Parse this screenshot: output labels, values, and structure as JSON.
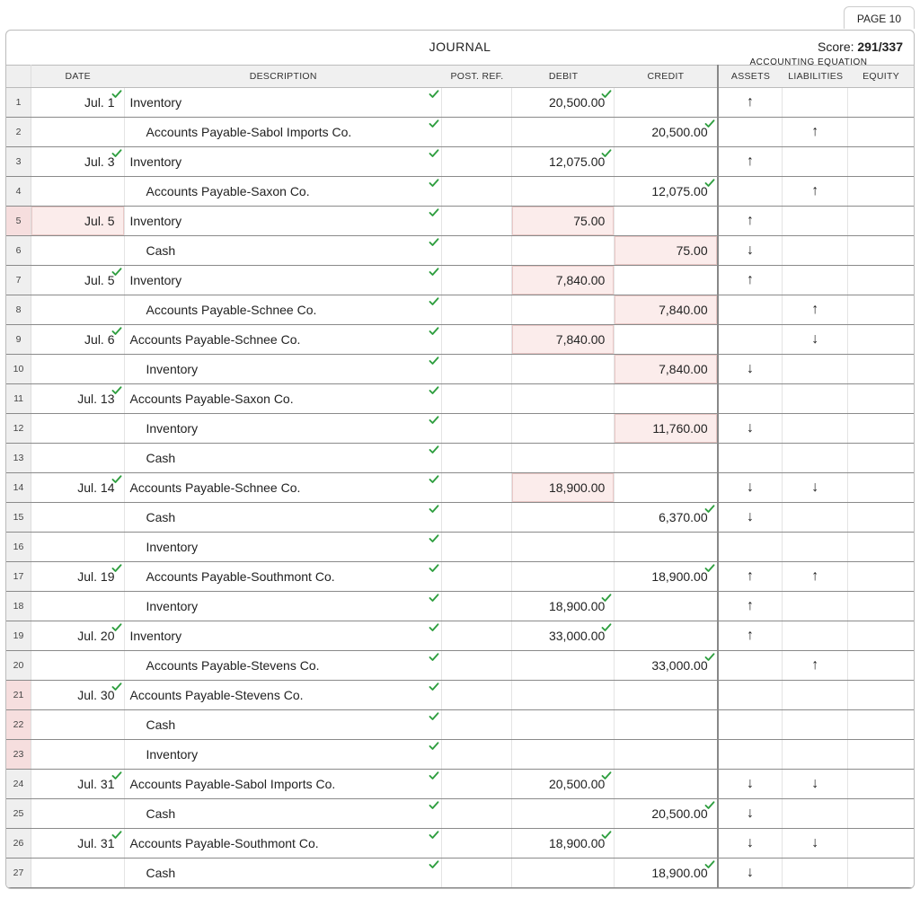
{
  "page_tab": "PAGE 10",
  "title": "JOURNAL",
  "score_label": "Score:",
  "score_value": "291/337",
  "ae_header": "ACCOUNTING EQUATION",
  "columns": {
    "date": "DATE",
    "description": "DESCRIPTION",
    "post_ref": "POST. REF.",
    "debit": "DEBIT",
    "credit": "CREDIT",
    "assets": "ASSETS",
    "liabilities": "LIABILITIES",
    "equity": "EQUITY"
  },
  "rows": [
    {
      "n": 1,
      "date": "Jul. 1",
      "date_chk": true,
      "desc": "Inventory",
      "desc_chk": true,
      "indent": false,
      "debit": "20,500.00",
      "debit_chk": true,
      "credit": "",
      "assets": "up",
      "liab": "",
      "row_err": false
    },
    {
      "n": 2,
      "date": "",
      "desc": "Accounts Payable-Sabol Imports Co.",
      "desc_chk": true,
      "indent": true,
      "debit": "",
      "credit": "20,500.00",
      "credit_chk": true,
      "assets": "",
      "liab": "up",
      "row_err": false
    },
    {
      "n": 3,
      "date": "Jul. 3",
      "date_chk": true,
      "desc": "Inventory",
      "desc_chk": true,
      "indent": false,
      "debit": "12,075.00",
      "debit_chk": true,
      "credit": "",
      "assets": "up",
      "liab": "",
      "row_err": false
    },
    {
      "n": 4,
      "date": "",
      "desc": "Accounts Payable-Saxon Co.",
      "desc_chk": true,
      "indent": true,
      "debit": "",
      "credit": "12,075.00",
      "credit_chk": true,
      "assets": "",
      "liab": "up",
      "row_err": false
    },
    {
      "n": 5,
      "date": "Jul. 5",
      "date_err": true,
      "desc": "Inventory",
      "desc_chk": true,
      "indent": false,
      "debit": "75.00",
      "debit_err": true,
      "credit": "",
      "assets": "up",
      "liab": "",
      "row_err": true
    },
    {
      "n": 6,
      "date": "",
      "desc": "Cash",
      "desc_chk": true,
      "indent": true,
      "debit": "",
      "credit": "75.00",
      "credit_err": true,
      "assets": "down",
      "liab": "",
      "row_err": false
    },
    {
      "n": 7,
      "date": "Jul. 5",
      "date_chk": true,
      "desc": "Inventory",
      "desc_chk": true,
      "indent": false,
      "debit": "7,840.00",
      "debit_err": true,
      "credit": "",
      "assets": "up",
      "liab": "",
      "row_err": false
    },
    {
      "n": 8,
      "date": "",
      "desc": "Accounts Payable-Schnee Co.",
      "desc_chk": true,
      "indent": true,
      "debit": "",
      "credit": "7,840.00",
      "credit_err": true,
      "assets": "",
      "liab": "up",
      "row_err": false
    },
    {
      "n": 9,
      "date": "Jul. 6",
      "date_chk": true,
      "desc": "Accounts Payable-Schnee Co.",
      "desc_chk": true,
      "indent": false,
      "debit": "7,840.00",
      "debit_err": true,
      "credit": "",
      "assets": "",
      "liab": "down",
      "row_err": false
    },
    {
      "n": 10,
      "date": "",
      "desc": "Inventory",
      "desc_chk": true,
      "indent": true,
      "debit": "",
      "credit": "7,840.00",
      "credit_err": true,
      "assets": "down",
      "liab": "",
      "row_err": false
    },
    {
      "n": 11,
      "date": "Jul. 13",
      "date_chk": true,
      "desc": "Accounts Payable-Saxon Co.",
      "desc_chk": true,
      "indent": false,
      "debit": "",
      "credit": "",
      "assets": "",
      "liab": "",
      "row_err": false
    },
    {
      "n": 12,
      "date": "",
      "desc": "Inventory",
      "desc_chk": true,
      "indent": true,
      "debit": "",
      "credit": "11,760.00",
      "credit_err": true,
      "assets": "down",
      "liab": "",
      "row_err": false
    },
    {
      "n": 13,
      "date": "",
      "desc": "Cash",
      "desc_chk": true,
      "indent": true,
      "debit": "",
      "credit": "",
      "assets": "",
      "liab": "",
      "row_err": false
    },
    {
      "n": 14,
      "date": "Jul. 14",
      "date_chk": true,
      "desc": "Accounts Payable-Schnee Co.",
      "desc_chk": true,
      "indent": false,
      "debit": "18,900.00",
      "debit_err": true,
      "credit": "",
      "assets": "down",
      "liab": "down",
      "row_err": false
    },
    {
      "n": 15,
      "date": "",
      "desc": "Cash",
      "desc_chk": true,
      "indent": true,
      "debit": "",
      "credit": "6,370.00",
      "credit_chk": true,
      "assets": "down",
      "liab": "",
      "row_err": false
    },
    {
      "n": 16,
      "date": "",
      "desc": "Inventory",
      "desc_chk": true,
      "indent": true,
      "debit": "",
      "credit": "",
      "assets": "",
      "liab": "",
      "row_err": false
    },
    {
      "n": 17,
      "date": "Jul. 19",
      "date_chk": true,
      "desc": "Accounts Payable-Southmont Co.",
      "desc_chk": true,
      "indent": true,
      "debit": "",
      "credit": "18,900.00",
      "credit_chk": true,
      "assets": "up",
      "liab": "up",
      "row_err": false
    },
    {
      "n": 18,
      "date": "",
      "desc": "Inventory",
      "desc_chk": true,
      "indent": true,
      "debit": "18,900.00",
      "debit_chk": true,
      "credit": "",
      "assets": "up",
      "liab": "",
      "row_err": false
    },
    {
      "n": 19,
      "date": "Jul. 20",
      "date_chk": true,
      "desc": "Inventory",
      "desc_chk": true,
      "indent": false,
      "debit": "33,000.00",
      "debit_chk": true,
      "credit": "",
      "assets": "up",
      "liab": "",
      "row_err": false
    },
    {
      "n": 20,
      "date": "",
      "desc": "Accounts Payable-Stevens Co.",
      "desc_chk": true,
      "indent": true,
      "debit": "",
      "credit": "33,000.00",
      "credit_chk": true,
      "assets": "",
      "liab": "up",
      "row_err": false
    },
    {
      "n": 21,
      "date": "Jul. 30",
      "date_chk": true,
      "desc": "Accounts Payable-Stevens Co.",
      "desc_chk": true,
      "indent": false,
      "debit": "",
      "credit": "",
      "assets": "",
      "liab": "",
      "row_err": true
    },
    {
      "n": 22,
      "date": "",
      "desc": "Cash",
      "desc_chk": true,
      "indent": true,
      "debit": "",
      "credit": "",
      "assets": "",
      "liab": "",
      "row_err": true
    },
    {
      "n": 23,
      "date": "",
      "desc": "Inventory",
      "desc_chk": true,
      "indent": true,
      "debit": "",
      "credit": "",
      "assets": "",
      "liab": "",
      "row_err": true
    },
    {
      "n": 24,
      "date": "Jul. 31",
      "date_chk": true,
      "desc": "Accounts Payable-Sabol Imports Co.",
      "desc_chk": true,
      "indent": false,
      "debit": "20,500.00",
      "debit_chk": true,
      "credit": "",
      "assets": "down",
      "liab": "down",
      "row_err": false
    },
    {
      "n": 25,
      "date": "",
      "desc": "Cash",
      "desc_chk": true,
      "indent": true,
      "debit": "",
      "credit": "20,500.00",
      "credit_chk": true,
      "assets": "down",
      "liab": "",
      "row_err": false
    },
    {
      "n": 26,
      "date": "Jul. 31",
      "date_chk": true,
      "desc": "Accounts Payable-Southmont Co.",
      "desc_chk": true,
      "indent": false,
      "debit": "18,900.00",
      "debit_chk": true,
      "credit": "",
      "assets": "down",
      "liab": "down",
      "row_err": false
    },
    {
      "n": 27,
      "date": "",
      "desc": "Cash",
      "desc_chk": true,
      "indent": true,
      "debit": "",
      "credit": "18,900.00",
      "credit_chk": true,
      "assets": "down",
      "liab": "",
      "row_err": false
    }
  ]
}
